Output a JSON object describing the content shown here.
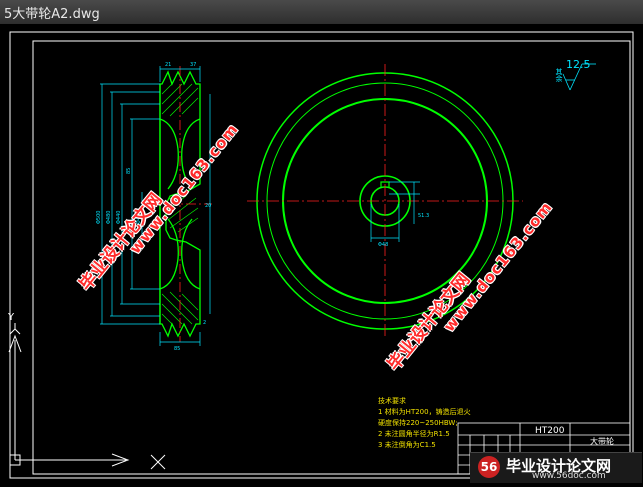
{
  "window": {
    "title": "5大带轮A2.dwg"
  },
  "drawing": {
    "roughness": {
      "value": "12.5",
      "label": "其余"
    },
    "notes": {
      "heading": "技术要求",
      "items": [
        "1  材料为HT200，铸造后退火",
        "   硬度保持220~250HBW;",
        "2  未注圆角半径为R1.5",
        "3  未注倒角为C1.5"
      ]
    },
    "title_block": {
      "material": "HT200",
      "part_name": "大带轮"
    },
    "colors": {
      "outline": "#00ff00",
      "dimension": "#00ffff",
      "center": "#ff0000",
      "text": "#ffff00",
      "frame": "#ffffff"
    }
  },
  "watermarks": {
    "stamp_text": "毕业设计论文网",
    "url_text": "www.doc163.com"
  },
  "footer": {
    "logo_text": "毕业设计论文网",
    "logo_url": "www.56doc.com",
    "logo_mark": "56"
  },
  "ucs": {
    "x_label": "X",
    "y_label": "Y"
  }
}
